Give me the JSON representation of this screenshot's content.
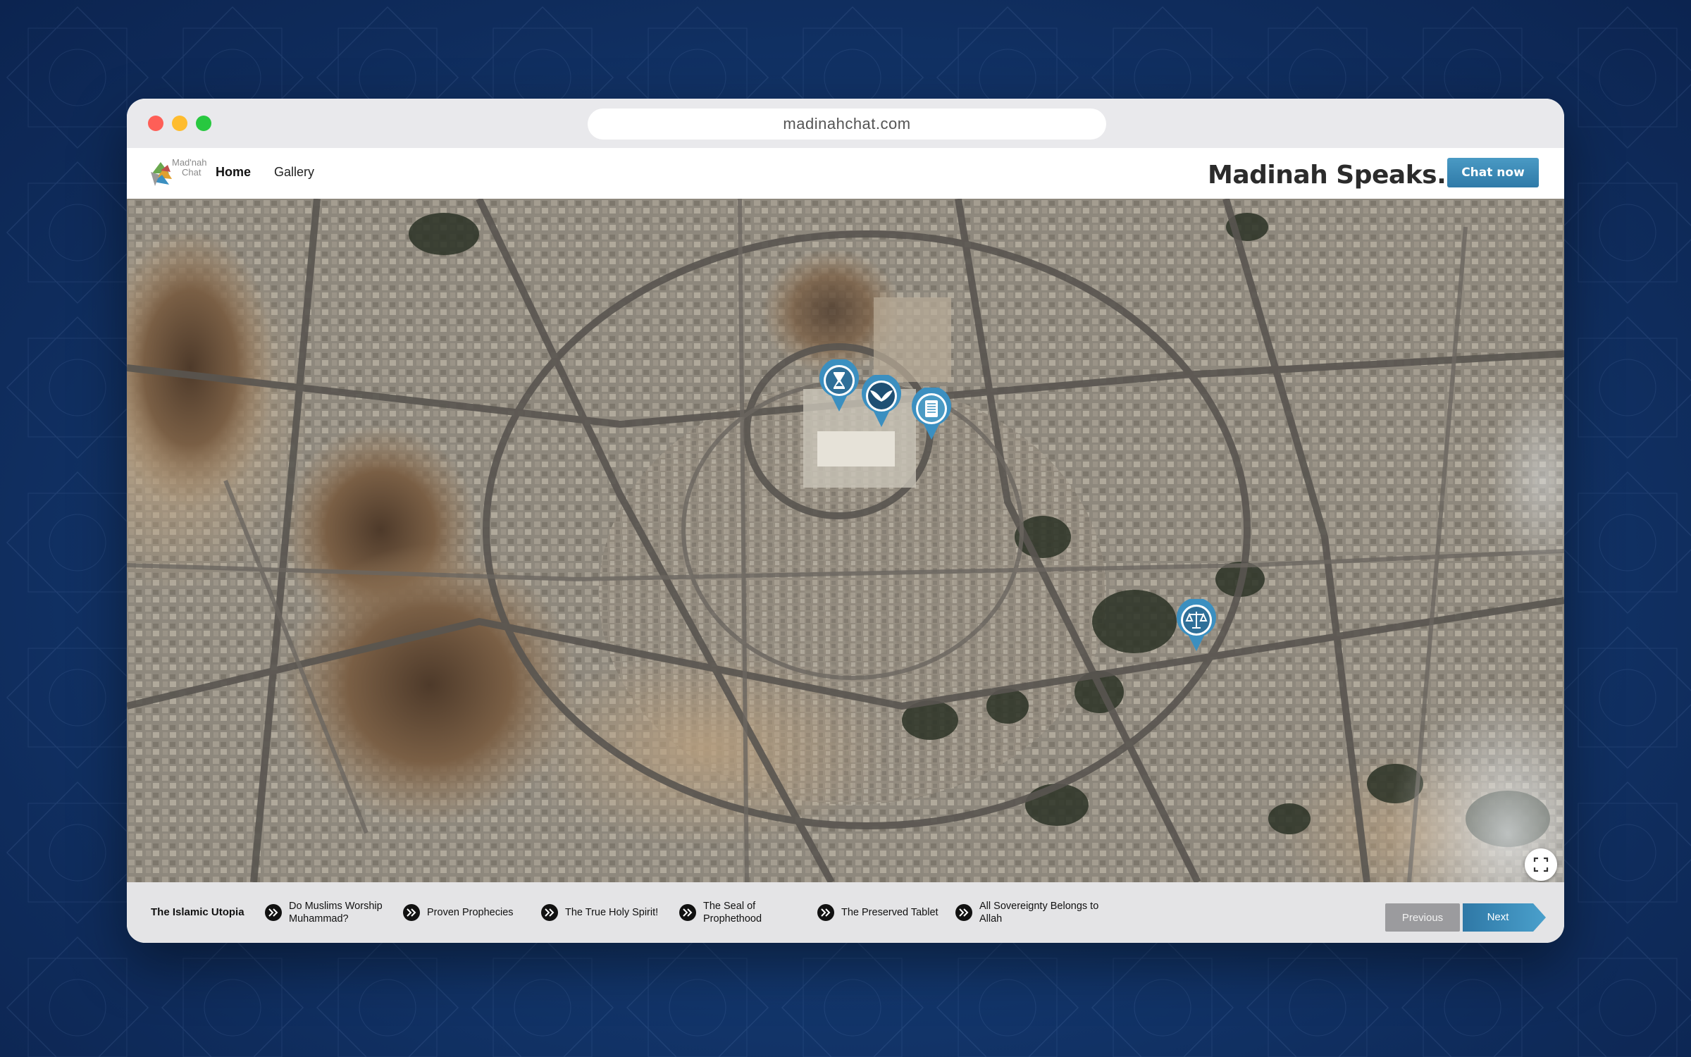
{
  "browser": {
    "url": "madinahchat.com"
  },
  "navbar": {
    "logo": {
      "line1": "Mad'nah",
      "line2": "Chat"
    },
    "home_label": "Home",
    "gallery_label": "Gallery",
    "brand_title": "Madinah Speaks..",
    "chat_button_label": "Chat now"
  },
  "map": {
    "type": "satellite",
    "markers": [
      {
        "name": "hourglass",
        "icon": "hourglass-icon"
      },
      {
        "name": "wings",
        "icon": "wings-icon"
      },
      {
        "name": "tablet",
        "icon": "document-icon"
      },
      {
        "name": "scales",
        "icon": "scales-icon"
      }
    ],
    "controls": {
      "fullscreen": "expand-icon"
    }
  },
  "footer": {
    "title": "The Islamic Utopia",
    "items": [
      {
        "label": "Do Muslims Worship Muhammad?"
      },
      {
        "label": "Proven Prophecies"
      },
      {
        "label": "The True Holy Spirit!"
      },
      {
        "label": "The Seal of Prophethood"
      },
      {
        "label": "The Preserved Tablet"
      },
      {
        "label": "All Sovereignty Belongs to Allah"
      }
    ],
    "prev_label": "Previous",
    "next_label": "Next"
  },
  "colors": {
    "accent": "#3a8ab8",
    "background": "#133a70",
    "marker": "#3b8fc0"
  }
}
